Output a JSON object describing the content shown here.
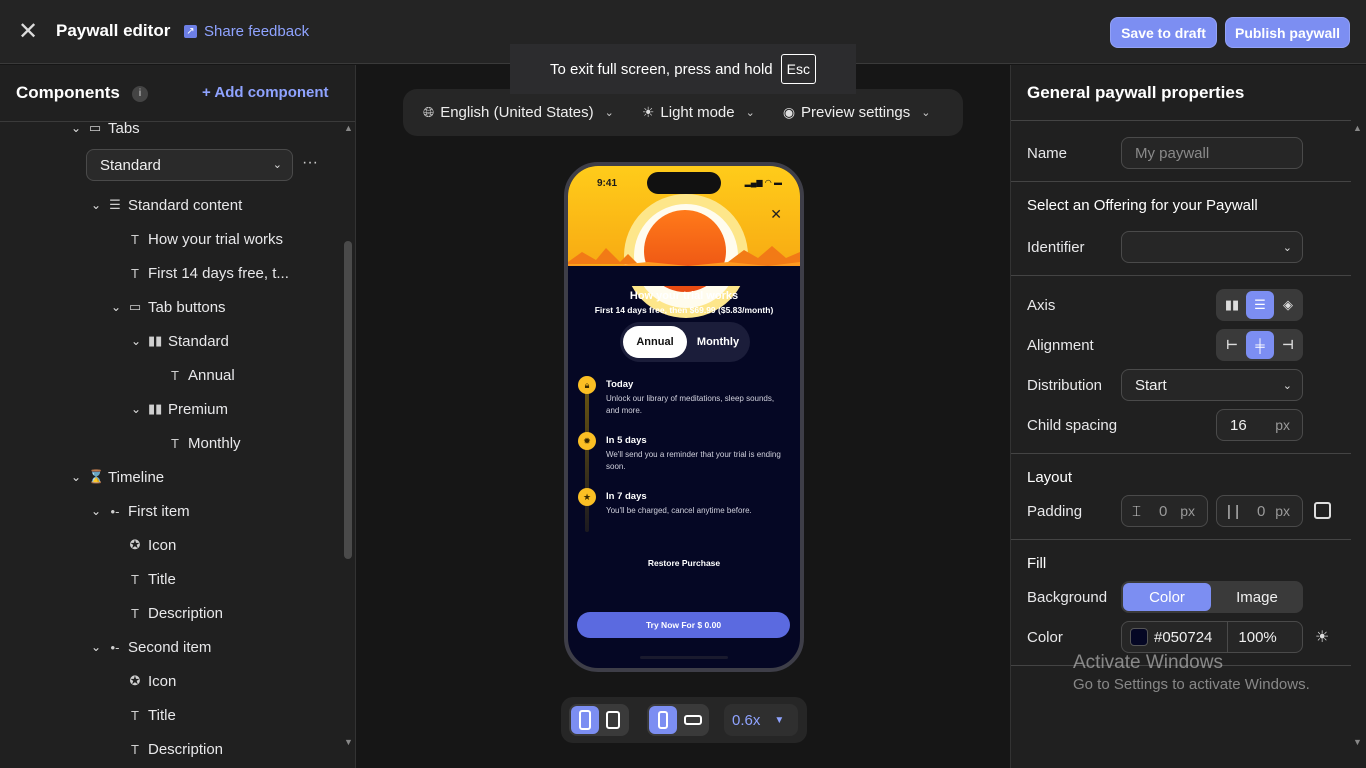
{
  "header": {
    "title": "Paywall editor",
    "feedback_label": "Share feedback",
    "save_draft_label": "Save to draft",
    "publish_label": "Publish paywall"
  },
  "fullscreen_toast": {
    "text": "To exit full screen, press and hold",
    "key": "Esc"
  },
  "components_panel": {
    "title": "Components",
    "info": "i",
    "add_label": "Add component",
    "tabs_label": "Tabs",
    "tab_select_value": "Standard",
    "tree": [
      {
        "label": "Standard content",
        "icon": "stack-icon"
      },
      {
        "label": "How your trial works",
        "icon": "text-icon"
      },
      {
        "label": "First 14 days free, t...",
        "icon": "text-icon"
      },
      {
        "label": "Tab buttons",
        "icon": "toggle-icon"
      },
      {
        "label": "Standard",
        "icon": "columns-icon"
      },
      {
        "label": "Annual",
        "icon": "text-icon"
      },
      {
        "label": "Premium",
        "icon": "columns-icon"
      },
      {
        "label": "Monthly",
        "icon": "text-icon"
      },
      {
        "label": "Timeline",
        "icon": "hourglass-icon"
      },
      {
        "label": "First item",
        "icon": "list-item-icon"
      },
      {
        "label": "Icon",
        "icon": "circle-icon"
      },
      {
        "label": "Title",
        "icon": "text-icon"
      },
      {
        "label": "Description",
        "icon": "text-icon"
      },
      {
        "label": "Second item",
        "icon": "list-item-icon"
      },
      {
        "label": "Icon",
        "icon": "circle-icon"
      },
      {
        "label": "Title",
        "icon": "text-icon"
      },
      {
        "label": "Description",
        "icon": "text-icon"
      }
    ]
  },
  "preview_bar": {
    "language": "English (United States)",
    "mode": "Light mode",
    "settings": "Preview settings"
  },
  "phone": {
    "time": "9:41",
    "title": "How your trial works",
    "subtitle": "First 14 days free, then $69.99 ($5.83/month)",
    "tab_annual": "Annual",
    "tab_monthly": "Monthly",
    "timeline": [
      {
        "title": "Today",
        "desc": "Unlock our library of meditations, sleep sounds, and more."
      },
      {
        "title": "In 5 days",
        "desc": "We'll send you a reminder that your trial is ending soon."
      },
      {
        "title": "In 7 days",
        "desc": "You'll be charged, cancel anytime before."
      }
    ],
    "restore": "Restore Purchase",
    "cta": "Try Now For $ 0.00"
  },
  "zoom": "0.6x",
  "properties": {
    "title": "General paywall properties",
    "name_label": "Name",
    "name_placeholder": "My paywall",
    "offering_heading": "Select an Offering for your Paywall",
    "identifier_label": "Identifier",
    "identifier_value": "",
    "axis_label": "Axis",
    "alignment_label": "Alignment",
    "distribution_label": "Distribution",
    "distribution_value": "Start",
    "child_spacing_label": "Child spacing",
    "child_spacing_value": "16",
    "unit_px": "px",
    "layout_heading": "Layout",
    "padding_label": "Padding",
    "padding_vertical": "0",
    "padding_horizontal": "0",
    "fill_heading": "Fill",
    "background_label": "Background",
    "bg_option_color": "Color",
    "bg_option_image": "Image",
    "color_label": "Color",
    "color_hex": "#050724",
    "color_opacity": "100%"
  },
  "watermark": {
    "line1": "Activate Windows",
    "line2": "Go to Settings to activate Windows."
  },
  "colors": {
    "accent": "#7c8ef2",
    "link": "#8fa3ff",
    "paywall_bg": "#050724",
    "cta": "#5b6ae0"
  }
}
